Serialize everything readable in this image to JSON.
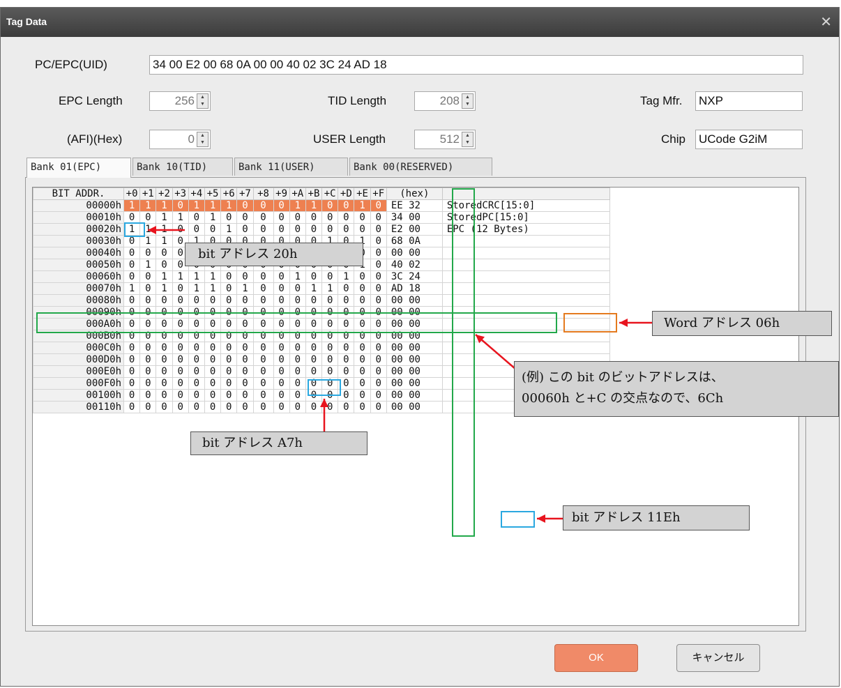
{
  "window": {
    "title": "Tag Data",
    "close_glyph": "✕"
  },
  "fields": {
    "pc_epc": {
      "label": "PC/EPC(UID)",
      "value": "34 00 E2 00 68 0A 00 00 40 02 3C 24 AD 18"
    },
    "epc_length": {
      "label": "EPC Length",
      "value": "256"
    },
    "tid_length": {
      "label": "TID Length",
      "value": "208"
    },
    "tag_mfr": {
      "label": "Tag Mfr.",
      "value": "NXP"
    },
    "afi": {
      "label": "(AFI)(Hex)",
      "value": "0"
    },
    "user_length": {
      "label": "USER Length",
      "value": "512"
    },
    "chip": {
      "label": "Chip",
      "value": "UCode G2iM"
    }
  },
  "tabs": [
    "Bank 01(EPC)",
    "Bank 10(TID)",
    "Bank 11(USER)",
    "Bank 00(RESERVED)"
  ],
  "grid": {
    "header": [
      "BIT ADDR.",
      "+0",
      "+1",
      "+2",
      "+3",
      "+4",
      "+5",
      "+6",
      "+7",
      "+8",
      "+9",
      "+A",
      "+B",
      "+C",
      "+D",
      "+E",
      "+F",
      "(hex)",
      ""
    ],
    "rows": [
      {
        "addr": "00000h",
        "bits": [
          "1",
          "1",
          "1",
          "0",
          "1",
          "1",
          "1",
          "0",
          "0",
          "0",
          "1",
          "1",
          "0",
          "0",
          "1",
          "0"
        ],
        "hex": "EE 32",
        "note": "StoredCRC[15:0]"
      },
      {
        "addr": "00010h",
        "bits": [
          "0",
          "0",
          "1",
          "1",
          "0",
          "1",
          "0",
          "0",
          "0",
          "0",
          "0",
          "0",
          "0",
          "0",
          "0",
          "0"
        ],
        "hex": "34 00",
        "note": "StoredPC[15:0]"
      },
      {
        "addr": "00020h",
        "bits": [
          "1",
          "1",
          "1",
          "0",
          "0",
          "0",
          "1",
          "0",
          "0",
          "0",
          "0",
          "0",
          "0",
          "0",
          "0",
          "0"
        ],
        "hex": "E2 00",
        "note": "EPC (12 Bytes)"
      },
      {
        "addr": "00030h",
        "bits": [
          "0",
          "1",
          "1",
          "0",
          "1",
          "0",
          "0",
          "0",
          "0",
          "0",
          "0",
          "0",
          "1",
          "0",
          "1",
          "0"
        ],
        "hex": "68 0A",
        "note": ""
      },
      {
        "addr": "00040h",
        "bits": [
          "0",
          "0",
          "0",
          "0",
          "0",
          "0",
          "0",
          "0",
          "0",
          "0",
          "0",
          "0",
          "0",
          "0",
          "0",
          "0"
        ],
        "hex": "00 00",
        "note": ""
      },
      {
        "addr": "00050h",
        "bits": [
          "0",
          "1",
          "0",
          "0",
          "0",
          "0",
          "0",
          "0",
          "0",
          "0",
          "0",
          "0",
          "0",
          "0",
          "1",
          "0"
        ],
        "hex": "40 02",
        "note": ""
      },
      {
        "addr": "00060h",
        "bits": [
          "0",
          "0",
          "1",
          "1",
          "1",
          "1",
          "0",
          "0",
          "0",
          "0",
          "1",
          "0",
          "0",
          "1",
          "0",
          "0"
        ],
        "hex": "3C 24",
        "note": ""
      },
      {
        "addr": "00070h",
        "bits": [
          "1",
          "0",
          "1",
          "0",
          "1",
          "1",
          "0",
          "1",
          "0",
          "0",
          "0",
          "1",
          "1",
          "0",
          "0",
          "0"
        ],
        "hex": "AD 18",
        "note": ""
      },
      {
        "addr": "00080h",
        "bits": [
          "0",
          "0",
          "0",
          "0",
          "0",
          "0",
          "0",
          "0",
          "0",
          "0",
          "0",
          "0",
          "0",
          "0",
          "0",
          "0"
        ],
        "hex": "00 00",
        "note": ""
      },
      {
        "addr": "00090h",
        "bits": [
          "0",
          "0",
          "0",
          "0",
          "0",
          "0",
          "0",
          "0",
          "0",
          "0",
          "0",
          "0",
          "0",
          "0",
          "0",
          "0"
        ],
        "hex": "00 00",
        "note": ""
      },
      {
        "addr": "000A0h",
        "bits": [
          "0",
          "0",
          "0",
          "0",
          "0",
          "0",
          "0",
          "0",
          "0",
          "0",
          "0",
          "0",
          "0",
          "0",
          "0",
          "0"
        ],
        "hex": "00 00",
        "note": ""
      },
      {
        "addr": "000B0h",
        "bits": [
          "0",
          "0",
          "0",
          "0",
          "0",
          "0",
          "0",
          "0",
          "0",
          "0",
          "0",
          "0",
          "0",
          "0",
          "0",
          "0"
        ],
        "hex": "00 00",
        "note": ""
      },
      {
        "addr": "000C0h",
        "bits": [
          "0",
          "0",
          "0",
          "0",
          "0",
          "0",
          "0",
          "0",
          "0",
          "0",
          "0",
          "0",
          "0",
          "0",
          "0",
          "0"
        ],
        "hex": "00 00",
        "note": ""
      },
      {
        "addr": "000D0h",
        "bits": [
          "0",
          "0",
          "0",
          "0",
          "0",
          "0",
          "0",
          "0",
          "0",
          "0",
          "0",
          "0",
          "0",
          "0",
          "0",
          "0"
        ],
        "hex": "00 00",
        "note": ""
      },
      {
        "addr": "000E0h",
        "bits": [
          "0",
          "0",
          "0",
          "0",
          "0",
          "0",
          "0",
          "0",
          "0",
          "0",
          "0",
          "0",
          "0",
          "0",
          "0",
          "0"
        ],
        "hex": "00 00",
        "note": ""
      },
      {
        "addr": "000F0h",
        "bits": [
          "0",
          "0",
          "0",
          "0",
          "0",
          "0",
          "0",
          "0",
          "0",
          "0",
          "0",
          "0",
          "0",
          "0",
          "0",
          "0"
        ],
        "hex": "00 00",
        "note": ""
      },
      {
        "addr": "00100h",
        "bits": [
          "0",
          "0",
          "0",
          "0",
          "0",
          "0",
          "0",
          "0",
          "0",
          "0",
          "0",
          "0",
          "0",
          "0",
          "0",
          "0"
        ],
        "hex": "00 00",
        "note": ""
      },
      {
        "addr": "00110h",
        "bits": [
          "0",
          "0",
          "0",
          "0",
          "0",
          "0",
          "0",
          "0",
          "0",
          "0",
          "0",
          "0",
          "0",
          "0",
          "0",
          "0"
        ],
        "hex": "00 00",
        "note": ""
      }
    ]
  },
  "annotations": {
    "bit_20h": "bit アドレス 20h",
    "bit_a7h": "bit アドレス A7h",
    "bit_11eh": "bit アドレス 11Eh",
    "word_06h": "Word アドレス 06h",
    "example_line1": "(例) この bit のビットアドレスは、",
    "example_line2": "00060h と+C の交点なので、6Ch",
    "arrow_color": "#e8141e"
  },
  "buttons": {
    "ok": "OK",
    "cancel": "キャンセル"
  },
  "colors": {
    "selected_row": "#ee8050",
    "ok_button": "#f08a68"
  }
}
